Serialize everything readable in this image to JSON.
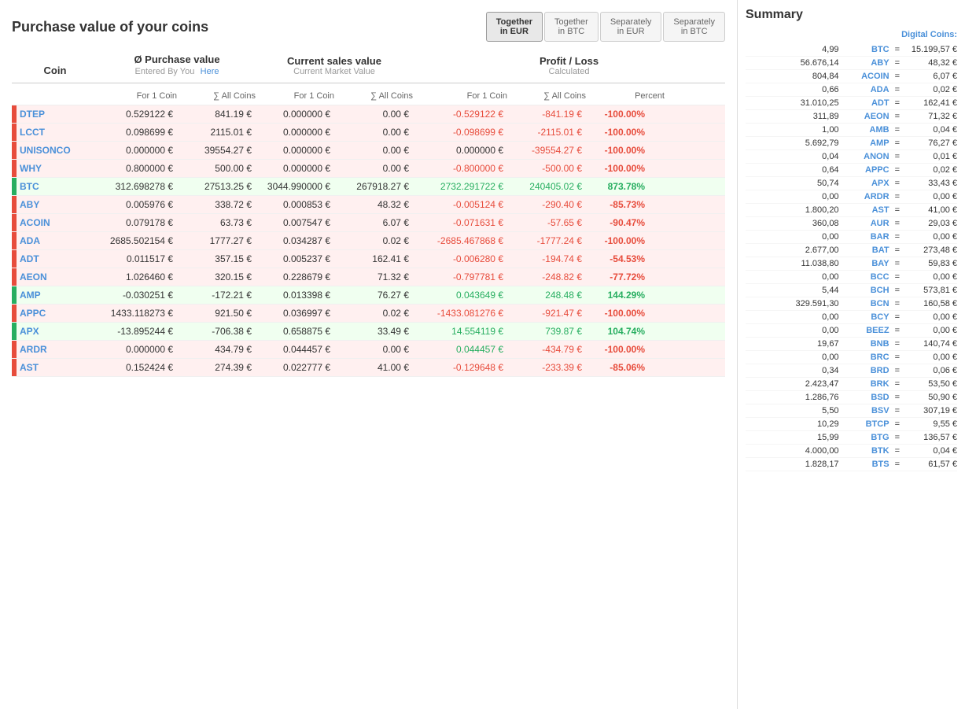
{
  "page": {
    "title": "Purchase value of your coins"
  },
  "tabs": [
    {
      "id": "together-eur",
      "label": "Together\nin EUR",
      "active": true
    },
    {
      "id": "together-btc",
      "label": "Together\nin BTC",
      "active": false
    },
    {
      "id": "separately-eur",
      "label": "Separately\nin EUR",
      "active": false
    },
    {
      "id": "separately-btc",
      "label": "Separately\nin BTC",
      "active": false
    }
  ],
  "table": {
    "headers": {
      "coin": "Coin",
      "purchase": "Ø Purchase value",
      "purchase_sub": "Entered By You",
      "purchase_link": "Here",
      "current": "Current sales value",
      "current_sub": "Current Market Value",
      "profit": "Profit / Loss",
      "profit_sub": "Calculated"
    },
    "subheaders": {
      "for1coin": "For 1 Coin",
      "allcoins": "∑ All Coins",
      "percent": "Percent"
    },
    "rows": [
      {
        "coin": "DTEP",
        "pv1": "0.529122 €",
        "pvAll": "841.19 €",
        "cv1": "0.000000 €",
        "cvAll": "0.00 €",
        "pl1": "-0.529122 €",
        "plAll": "-841.19 €",
        "pct": "-100.00%",
        "type": "loss"
      },
      {
        "coin": "LCCT",
        "pv1": "0.098699 €",
        "pvAll": "2115.01 €",
        "cv1": "0.000000 €",
        "cvAll": "0.00 €",
        "pl1": "-0.098699 €",
        "plAll": "-2115.01 €",
        "pct": "-100.00%",
        "type": "loss"
      },
      {
        "coin": "UNISONCO",
        "pv1": "0.000000 €",
        "pvAll": "39554.27 €",
        "cv1": "0.000000 €",
        "cvAll": "0.00 €",
        "pl1": "0.000000 €",
        "plAll": "-39554.27 €",
        "pct": "-100.00%",
        "type": "loss"
      },
      {
        "coin": "WHY",
        "pv1": "0.800000 €",
        "pvAll": "500.00 €",
        "cv1": "0.000000 €",
        "cvAll": "0.00 €",
        "pl1": "-0.800000 €",
        "plAll": "-500.00 €",
        "pct": "-100.00%",
        "type": "loss"
      },
      {
        "coin": "BTC",
        "pv1": "312.698278 €",
        "pvAll": "27513.25 €",
        "cv1": "3044.990000 €",
        "cvAll": "267918.27 €",
        "pl1": "2732.291722 €",
        "plAll": "240405.02 €",
        "pct": "873.78%",
        "type": "gain"
      },
      {
        "coin": "ABY",
        "pv1": "0.005976 €",
        "pvAll": "338.72 €",
        "cv1": "0.000853 €",
        "cvAll": "48.32 €",
        "pl1": "-0.005124 €",
        "plAll": "-290.40 €",
        "pct": "-85.73%",
        "type": "loss"
      },
      {
        "coin": "ACOIN",
        "pv1": "0.079178 €",
        "pvAll": "63.73 €",
        "cv1": "0.007547 €",
        "cvAll": "6.07 €",
        "pl1": "-0.071631 €",
        "plAll": "-57.65 €",
        "pct": "-90.47%",
        "type": "loss"
      },
      {
        "coin": "ADA",
        "pv1": "2685.502154 €",
        "pvAll": "1777.27 €",
        "cv1": "0.034287 €",
        "cvAll": "0.02 €",
        "pl1": "-2685.467868 €",
        "plAll": "-1777.24 €",
        "pct": "-100.00%",
        "type": "loss"
      },
      {
        "coin": "ADT",
        "pv1": "0.011517 €",
        "pvAll": "357.15 €",
        "cv1": "0.005237 €",
        "cvAll": "162.41 €",
        "pl1": "-0.006280 €",
        "plAll": "-194.74 €",
        "pct": "-54.53%",
        "type": "loss"
      },
      {
        "coin": "AEON",
        "pv1": "1.026460 €",
        "pvAll": "320.15 €",
        "cv1": "0.228679 €",
        "cvAll": "71.32 €",
        "pl1": "-0.797781 €",
        "plAll": "-248.82 €",
        "pct": "-77.72%",
        "type": "loss"
      },
      {
        "coin": "AMP",
        "pv1": "-0.030251 €",
        "pvAll": "-172.21 €",
        "cv1": "0.013398 €",
        "cvAll": "76.27 €",
        "pl1": "0.043649 €",
        "plAll": "248.48 €",
        "pct": "144.29%",
        "type": "gain"
      },
      {
        "coin": "APPC",
        "pv1": "1433.118273 €",
        "pvAll": "921.50 €",
        "cv1": "0.036997 €",
        "cvAll": "0.02 €",
        "pl1": "-1433.081276 €",
        "plAll": "-921.47 €",
        "pct": "-100.00%",
        "type": "loss"
      },
      {
        "coin": "APX",
        "pv1": "-13.895244 €",
        "pvAll": "-706.38 €",
        "cv1": "0.658875 €",
        "cvAll": "33.49 €",
        "pl1": "14.554119 €",
        "plAll": "739.87 €",
        "pct": "104.74%",
        "type": "gain"
      },
      {
        "coin": "ARDR",
        "pv1": "0.000000 €",
        "pvAll": "434.79 €",
        "cv1": "0.044457 €",
        "cvAll": "0.00 €",
        "pl1": "0.044457 €",
        "plAll": "-434.79 €",
        "pct": "-100.00%",
        "type": "loss"
      },
      {
        "coin": "AST",
        "pv1": "0.152424 €",
        "pvAll": "274.39 €",
        "cv1": "0.022777 €",
        "cvAll": "41.00 €",
        "pl1": "-0.129648 €",
        "plAll": "-233.39 €",
        "pct": "-85.06%",
        "type": "loss"
      }
    ]
  },
  "summary": {
    "title": "Summary",
    "header": "Digital Coins:",
    "rows": [
      {
        "amount": "4,99",
        "coin": "BTC",
        "value": "15.199,57 €"
      },
      {
        "amount": "56.676,14",
        "coin": "ABY",
        "value": "48,32 €"
      },
      {
        "amount": "804,84",
        "coin": "ACOIN",
        "value": "6,07 €"
      },
      {
        "amount": "0,66",
        "coin": "ADA",
        "value": "0,02 €"
      },
      {
        "amount": "31.010,25",
        "coin": "ADT",
        "value": "162,41 €"
      },
      {
        "amount": "311,89",
        "coin": "AEON",
        "value": "71,32 €"
      },
      {
        "amount": "1,00",
        "coin": "AMB",
        "value": "0,04 €"
      },
      {
        "amount": "5.692,79",
        "coin": "AMP",
        "value": "76,27 €"
      },
      {
        "amount": "0,04",
        "coin": "ANON",
        "value": "0,01 €"
      },
      {
        "amount": "0,64",
        "coin": "APPC",
        "value": "0,02 €"
      },
      {
        "amount": "50,74",
        "coin": "APX",
        "value": "33,43 €"
      },
      {
        "amount": "0,00",
        "coin": "ARDR",
        "value": "0,00 €"
      },
      {
        "amount": "1.800,20",
        "coin": "AST",
        "value": "41,00 €"
      },
      {
        "amount": "360,08",
        "coin": "AUR",
        "value": "29,03 €"
      },
      {
        "amount": "0,00",
        "coin": "BAR",
        "value": "0,00 €"
      },
      {
        "amount": "2.677,00",
        "coin": "BAT",
        "value": "273,48 €"
      },
      {
        "amount": "11.038,80",
        "coin": "BAY",
        "value": "59,83 €"
      },
      {
        "amount": "0,00",
        "coin": "BCC",
        "value": "0,00 €"
      },
      {
        "amount": "5,44",
        "coin": "BCH",
        "value": "573,81 €"
      },
      {
        "amount": "329.591,30",
        "coin": "BCN",
        "value": "160,58 €"
      },
      {
        "amount": "0,00",
        "coin": "BCY",
        "value": "0,00 €"
      },
      {
        "amount": "0,00",
        "coin": "BEEZ",
        "value": "0,00 €"
      },
      {
        "amount": "19,67",
        "coin": "BNB",
        "value": "140,74 €"
      },
      {
        "amount": "0,00",
        "coin": "BRC",
        "value": "0,00 €"
      },
      {
        "amount": "0,34",
        "coin": "BRD",
        "value": "0,06 €"
      },
      {
        "amount": "2.423,47",
        "coin": "BRK",
        "value": "53,50 €"
      },
      {
        "amount": "1.286,76",
        "coin": "BSD",
        "value": "50,90 €"
      },
      {
        "amount": "5,50",
        "coin": "BSV",
        "value": "307,19 €"
      },
      {
        "amount": "10,29",
        "coin": "BTCP",
        "value": "9,55 €"
      },
      {
        "amount": "15,99",
        "coin": "BTG",
        "value": "136,57 €"
      },
      {
        "amount": "4.000,00",
        "coin": "BTK",
        "value": "0,04 €"
      },
      {
        "amount": "1.828,17",
        "coin": "BTS",
        "value": "61,57 €"
      }
    ]
  }
}
